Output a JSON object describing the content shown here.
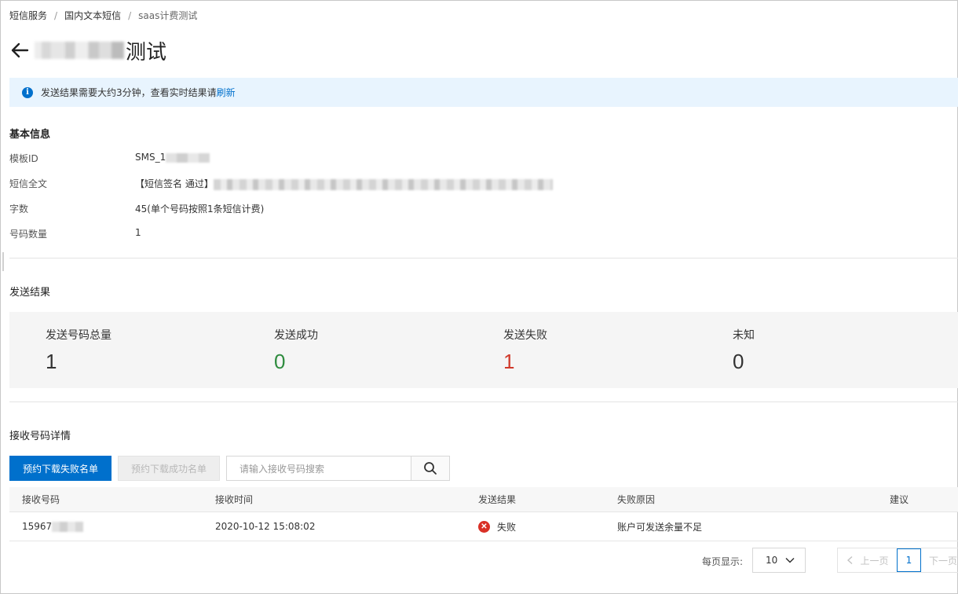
{
  "breadcrumb": {
    "items": [
      "短信服务",
      "国内文本短信"
    ],
    "current": "saas计费测试",
    "separator": "/"
  },
  "header": {
    "title_suffix": "测试",
    "back_icon": "arrow-left-icon"
  },
  "notice": {
    "text": "发送结果需要大约3分钟，查看实时结果请",
    "link": "刷新",
    "icon": "info-icon"
  },
  "basic_info": {
    "title": "基本信息",
    "rows": [
      {
        "key": "模板ID",
        "value": "SMS_1"
      },
      {
        "key": "短信全文",
        "value": "【短信签名 通过】"
      },
      {
        "key": "字数",
        "value": "45(单个号码按照1条短信计费)"
      },
      {
        "key": "号码数量",
        "value": "1"
      }
    ]
  },
  "send_result": {
    "title": "发送结果",
    "stats": [
      {
        "label": "发送号码总量",
        "value": "1"
      },
      {
        "label": "发送成功",
        "value": "0"
      },
      {
        "label": "发送失败",
        "value": "1"
      },
      {
        "label": "未知",
        "value": "0"
      }
    ]
  },
  "receiver_detail": {
    "title": "接收号码详情",
    "download_fail_label": "预约下载失败名单",
    "download_success_label": "预约下载成功名单",
    "search_placeholder": "请输入接收号码搜索",
    "search_icon": "search-icon",
    "columns": [
      "接收号码",
      "接收时间",
      "发送结果",
      "失败原因",
      "建议"
    ],
    "rows": [
      {
        "phone": "15967",
        "time": "2020-10-12 15:08:02",
        "result": "失败",
        "reason": "账户可发送余量不足",
        "suggestion": ""
      }
    ]
  },
  "pagination": {
    "page_size_label": "每页显示:",
    "page_size": "10",
    "prev_label": "上一页",
    "current_page": "1",
    "next_label": "下一页"
  },
  "colors": {
    "primary": "#0070cc",
    "success": "#2e8b3e",
    "danger": "#d03a2b",
    "notice_bg": "#e8f4fe"
  }
}
